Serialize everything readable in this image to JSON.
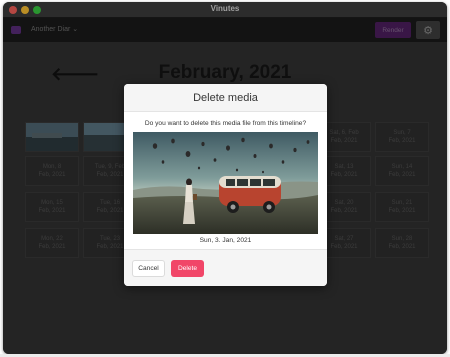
{
  "window": {
    "title": "Vinutes"
  },
  "toolbar": {
    "diary_name": "Another Diar",
    "render_label": "Render"
  },
  "calendar": {
    "month_title": "February, 2021",
    "cells": [
      {
        "line1": "Sun, 7",
        "line2": "Feb, 2021"
      },
      {
        "line1": "Sat, 6, Feb",
        "line2": "Feb, 2021"
      },
      {
        "line1": "Mon, 8",
        "line2": "Feb, 2021"
      },
      {
        "line1": "Tue, 9, Feb",
        "line2": "Feb, 2021"
      },
      {
        "line1": "Sat, 13",
        "line2": "Feb, 2021"
      },
      {
        "line1": "Sun, 14",
        "line2": "Feb, 2021"
      },
      {
        "line1": "Mon, 15",
        "line2": "Feb, 2021"
      },
      {
        "line1": "Tue, 16",
        "line2": "Feb, 2021"
      },
      {
        "line1": "Sat, 20",
        "line2": "Feb, 2021"
      },
      {
        "line1": "Sun, 21",
        "line2": "Feb, 2021"
      },
      {
        "line1": "Mon, 22",
        "line2": "Feb, 2021"
      },
      {
        "line1": "Tue, 23",
        "line2": "Feb, 2021"
      },
      {
        "line1": "Sat, 27",
        "line2": "Feb, 2021"
      },
      {
        "line1": "Sun, 28",
        "line2": "Feb, 2021"
      }
    ]
  },
  "modal": {
    "title": "Delete media",
    "question": "Do you want to delete this media file from this timeline?",
    "media_date": "Sun, 3. Jan, 2021",
    "cancel_label": "Cancel",
    "delete_label": "Delete"
  },
  "colors": {
    "danger": "#f14668",
    "brand": "#5a2d7a"
  }
}
